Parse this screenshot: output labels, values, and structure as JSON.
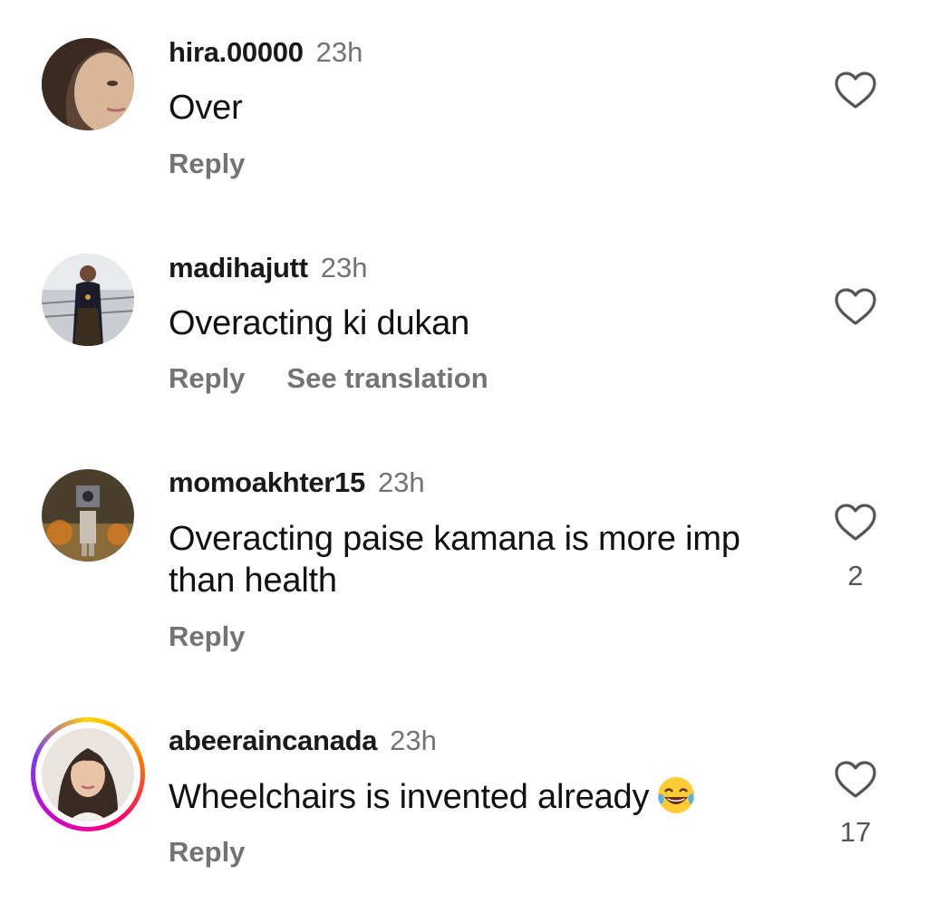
{
  "comments": [
    {
      "username": "hira.00000",
      "time": "23h",
      "text": "Over",
      "actions": [
        "Reply"
      ],
      "likes": ""
    },
    {
      "username": "madihajutt",
      "time": "23h",
      "text": "Overacting ki dukan",
      "actions": [
        "Reply",
        "See translation"
      ],
      "likes": ""
    },
    {
      "username": "momoakhter15",
      "time": "23h",
      "text": "Overacting paise kamana is more imp than health",
      "actions": [
        "Reply"
      ],
      "likes": "2"
    },
    {
      "username": "abeeraincanada",
      "time": "23h",
      "text": "Wheelchairs is invented already",
      "emoji": "tears-of-joy-emoji",
      "actions": [
        "Reply"
      ],
      "likes": "17",
      "has_story_ring": true
    }
  ],
  "colors": {
    "text": "#111111",
    "secondary": "#737373",
    "story_ring": [
      "#ffd600",
      "#ff7a00",
      "#ff0069",
      "#d300c5"
    ]
  }
}
